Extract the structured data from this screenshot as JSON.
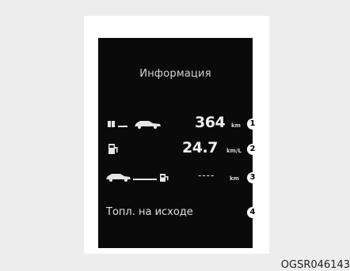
{
  "screen": {
    "title": "Информация",
    "rows": [
      {
        "value": "364",
        "unit": "km",
        "callout": "1"
      },
      {
        "value": "24.7",
        "unit": "km/L",
        "callout": "2"
      },
      {
        "value": "----",
        "unit": "km",
        "callout": "3"
      },
      {
        "text": "Топл. на исходе",
        "callout": "4"
      }
    ]
  },
  "caption": "OGSR046143"
}
